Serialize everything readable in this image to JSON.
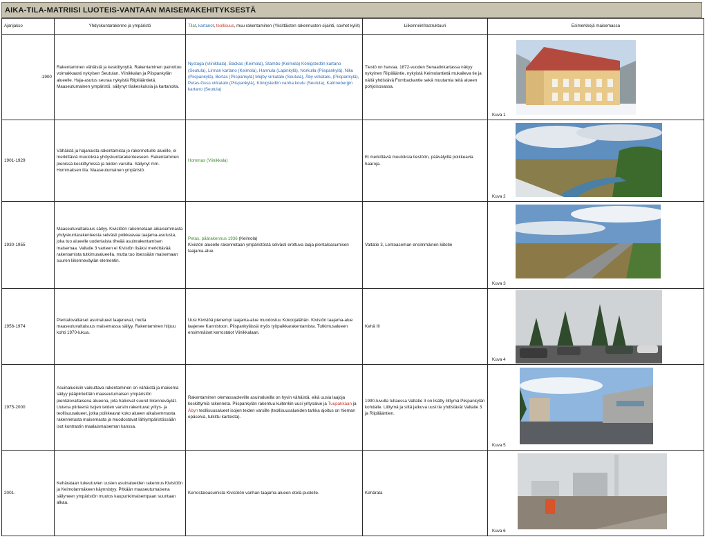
{
  "title": "AIKA-TILA-MATRIISI LUOTEIS-VANTAAN MAISEMAKEHITYKSESTÄ",
  "headers": {
    "period": "Ajanjakso",
    "structure": "Yhdyskuntarakenne ja ympäristö",
    "col3": {
      "p1": "Tilat",
      "p2": "kartanot",
      "p3": "teollisuus",
      "p4": ", muu rakentaminen (Yksittäisten rakennusten sijainti, sovhet kyliit)",
      "sep": ", "
    },
    "infra": "Liikenneinfrastruktuuri",
    "examples": "Esimerkkejä maisemassa"
  },
  "rows": [
    {
      "period": "-1900",
      "structure": "Rakentaminen vähäistä ja keskittynyttä. Rakentaminen painottuu voimakkaasti nykyisen Seutulan, Viinikkalan ja Piispankylän alueelle. Haja-asutus seuraa nykyistä Riipilääntietä. Maaseutumainen ympäristö, säilynyt tilakeskuksia ja kartanoita.",
      "buildings": "Nystuga (Viinikkala), Backas (Keimola), Stambo (Keimola) Königstedtin kartano (Seutula), Linnan kartano (Keimola), Hannula (Lapinkylä), Norkulla (Piispankylä), Niku (Piispankylä), Bertas (Piispankylä) Mejby virkatalo (Seutula), Äby virkatalo, (Piispankylä), Petas-Guss virkatalo (Piispankylä), Königstedtin vanha koulu (Seutula), Katrinebergin kartano (Seutula)",
      "infra": "Tiestö on harvaa. 1872-vuoden Senaatinkartassa näkyy nykyinen Riipilääntie, nykyistä Keimolantietä mukaileva tie ja näitä yhdistävä Fornbackantie sekä muutamia teitä alueen pohjoisosassa.",
      "caption": "Kuva 1"
    },
    {
      "period": "1901-1929",
      "structure": "Vähäistä ja hajanaista rakentamista jo rakennetuille alueille, ei merkittäviä muutoksia yhdyskuntarakenteeseen. Rakentaminen pienissä keskittymissä ja teiden varsilla. Säilynyt mm. Hommaksen tila. Maaseutumainen ympäristö.",
      "buildings": "Hommas (Viinikkala)",
      "infra": "Ei merkittäviä muutoksia tiestöön, päävälyiltä poikkeavia haaroja.",
      "caption": "Kuva 2"
    },
    {
      "period": "1930-1955",
      "structure": "Maaseutuvaltaisuus säilyy. Kivistöön rakennetaan aikaisemmasta yhdyskuntarakenteesta selvästi poikkeavaa taajama-asutusta, joka tuo alueelle uudenlaista tiheää asuinrakentamisen maisemaa. Valtatie 3 varteen ei Kivistön lisäksi merkittävää rakentamista tutkimusalueella, mutta tuo itsessään maisemaan suuren liikenneväylän elementin.",
      "buildings_colored": "Petas, päärakennus 1936",
      "buildings_colored_place": " (Keimola)",
      "buildings": "Kivistön alueelle rakennetaan ympäristöstä selvästi erottuva laaja pientaloasumisen taajama-alue.",
      "infra": "Valtatie 3, Lentoaseman ensimmäinen kiitotie",
      "caption": "Kuva 3"
    },
    {
      "period": "1956-1974",
      "structure": "Pientalovaltaiset asuinalueet laajenevat, mutta maaseutuvaltaisuus maisemassa säilyy. Rakentaminen hiipuu kohti 1970-lukua.",
      "buildings": "Uusi Kivistöä pienempi taajama-alue muodostuu Kokoojalähän. Kivistön taajama-alue laajenee Kannistoon. Piispankylässä myös työpaikkarakentamista. Tutkimusalueen ensimmäiset kerrostalot Viinikkalaan.",
      "infra": "Kehä III",
      "caption": "Kuva 4"
    },
    {
      "period": "1975-2000",
      "structure": "Asuinalueisiin vaikuttava rakentaminen on vähäistä ja maisema säilyy pääpiirteittäin maaseutumaisen ympäristön pientalovaltaisena alueena, jota halkovat suuret liikenneväylät. Uutena piirteenä isojen teiden varsiin rakentuvat yritys- ja teollisuusalueet, jotka poikkeavat koko alueen aikaisemmasta rakennetusta maisemasta ja muodostavat lähiympäristössään isot kontrastin maalaismaiseman kanssa.",
      "buildings_pre": "Rakentaminen olemassaoleville asuinalueilla on hyvin vähäistä, eikä uusia laajoja keskittymiä rakenneta. Piispankylän rakentuu kuitenkin uusi yritysalue ja ",
      "buildings_red": "Tuupakkaan",
      "buildings_mid": " ja ",
      "buildings_red2": "Äbyn",
      "buildings_post": " teollisuusalueet isojen teiden varsille (teollisuusalueiden tarkka ajoitus on hieman epäselvä, tulkittu kartoista).",
      "infra": "1990-luvulla tultaessa Valtatie 3 on lisätty liittymä Piispankylän kohdalle. Liittymä ja siitä jatkuva uusi tie yhdistävät Valtatie 3 ja Riipilääntien.",
      "caption": "Kuva 5"
    },
    {
      "period": "2001-",
      "structure": "Kehärataan tukeutuvien uusien asuinalueiden rakennus Kivistöön ja Keimolanmäkeen käynnistyy. Pitkään maaseutumaisena säilyneen ympäristön muutos kaupunkimaisempaan suuntaan alkaa.",
      "buildings": "Kerrostaloasumista Kivistöön vanhan taajama-alueen etelä-puolelle.",
      "infra": "Kehärata",
      "caption": "Kuva 6"
    }
  ]
}
